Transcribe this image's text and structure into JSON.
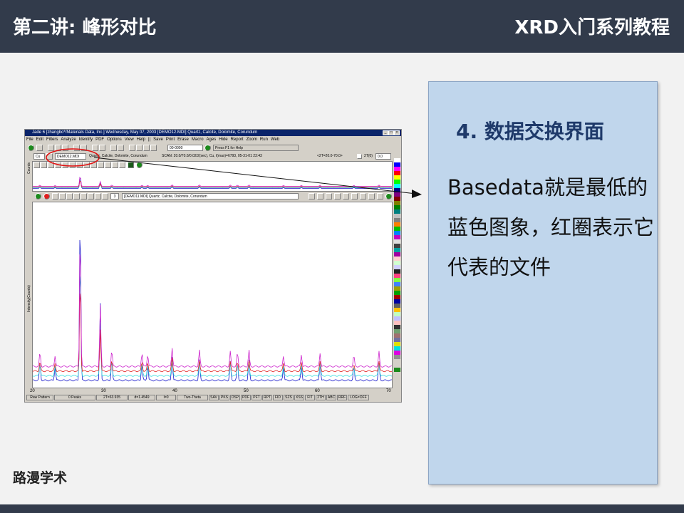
{
  "header": {
    "left_title": "第二讲: 峰形对比",
    "right_title": "XRD入门系列教程"
  },
  "footer": {
    "brand": "路漫学术"
  },
  "panel": {
    "heading": "4. 数据交换界面",
    "body": "Basedata就是最低的蓝色图象，红圈表示它代表的文件"
  },
  "jade": {
    "title": "Jade 6 [zhangbo*/Materials Data, Inc.] Wednesday, May 07, 2003 [DEMO12.MDI] Quartz, Calcite, Dolomite, Corundum",
    "menu": [
      "File",
      "Edit",
      "Filters",
      "Analyze",
      "Identify",
      "PDF",
      "Options",
      "View",
      "Help",
      "||",
      "Save",
      "Print",
      "Erase",
      "Macro",
      "Ages",
      "Hide",
      "Report",
      "Zoom",
      "Run",
      "Web"
    ],
    "pattern_field": "00-0000",
    "help_text": "Press F1 for Help",
    "tube": "Cu",
    "file_field": "DEMO12.MDI",
    "phase_text": "Quartz, Calcite, Dolomite, Corundum",
    "scan_text": "SCAN: 20.0/70.0/0.02/2(sec), Cu, I(max)=6793, 05-31-01 23:43",
    "range_text": "<2T=20.0-70.0>",
    "twotheta_label": "2T(0)",
    "twotheta_value": "0.0",
    "top_ylabel": "Counts",
    "overlay_count": "3",
    "overlay_field": "[DEMO11.MDI] Quartz, Calcite, Dolomite, Corundum",
    "main_ylabel": "Intensity(Counts)",
    "x_ticks": [
      "20",
      "30",
      "40",
      "50",
      "60",
      "70"
    ],
    "status": [
      "Raw Pattern",
      "0 Peaks",
      "2T=63.935",
      "d=1.4549",
      "I=0",
      "Two-Theta",
      "SAV",
      "PKS",
      "DSP",
      "PDF",
      "PFT",
      "RPT",
      "FID",
      "SZS",
      "XSS",
      "FIT",
      "2TH",
      "ABC",
      "RRF",
      "LOG=OFF"
    ]
  },
  "chart_data": {
    "type": "line",
    "xlabel": "",
    "ylabel": "Intensity(Counts)",
    "xlim": [
      20,
      70
    ],
    "x_ticks": [
      20,
      30,
      40,
      50,
      60,
      70
    ],
    "peaks": [
      {
        "x": 21.0,
        "h": 0.1
      },
      {
        "x": 23.1,
        "h": 0.08
      },
      {
        "x": 26.6,
        "h": 1.0
      },
      {
        "x": 29.4,
        "h": 0.45
      },
      {
        "x": 31.0,
        "h": 0.12
      },
      {
        "x": 35.2,
        "h": 0.1
      },
      {
        "x": 36.0,
        "h": 0.09
      },
      {
        "x": 39.4,
        "h": 0.14
      },
      {
        "x": 43.2,
        "h": 0.12
      },
      {
        "x": 47.5,
        "h": 0.11
      },
      {
        "x": 48.5,
        "h": 0.1
      },
      {
        "x": 50.1,
        "h": 0.12
      },
      {
        "x": 54.9,
        "h": 0.08
      },
      {
        "x": 57.4,
        "h": 0.09
      },
      {
        "x": 60.0,
        "h": 0.1
      },
      {
        "x": 64.7,
        "h": 0.08
      },
      {
        "x": 68.2,
        "h": 0.11
      }
    ],
    "series": [
      {
        "color": "#1a1acc",
        "offset": 0.0,
        "scale": 1.0
      },
      {
        "color": "#33dddd",
        "offset": 0.05,
        "scale": 0.7
      },
      {
        "color": "#e02020",
        "offset": 0.1,
        "scale": 0.55
      },
      {
        "color": "#cc22cc",
        "offset": 0.15,
        "scale": 0.8
      }
    ]
  },
  "colors": {
    "header_bg": "#323b4b",
    "panel_bg": "#c0d6ec",
    "heading": "#1f3a6a",
    "highlight_circle": "#e01010"
  }
}
